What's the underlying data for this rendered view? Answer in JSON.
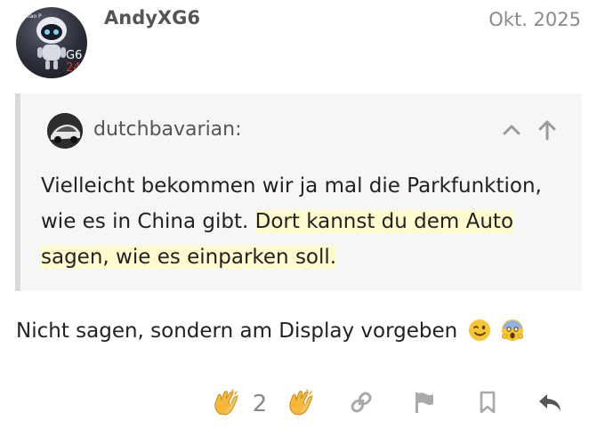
{
  "post": {
    "author": "AndyXG6",
    "date": "Okt. 2025",
    "avatar_badge_top": "G6",
    "avatar_badge_bottom": "24",
    "avatar_caption": "Xiao P"
  },
  "quote": {
    "author": "dutchbavarian:",
    "text_plain": "Vielleicht bekommen wir ja mal die Parkfunktion, wie es in China gibt. ",
    "text_highlighted": "Dort kannst du dem Auto sagen, wie es einparken soll.",
    "controls": [
      "chevron-up-icon",
      "arrow-up-icon"
    ]
  },
  "reply": {
    "text": "Nicht sagen, sondern am Display vorgeben",
    "emojis": [
      "winking-face",
      "face-screaming"
    ]
  },
  "actions": {
    "like_count": "2",
    "icons": [
      "clapping-hands-icon",
      "clapping-hands-icon",
      "link-icon",
      "flag-icon",
      "bookmark-icon",
      "reply-icon"
    ]
  },
  "colors": {
    "highlight": "#fffbcf",
    "quote_bg": "#f6f6f6",
    "quote_border": "#d9d9d9",
    "muted": "#888888",
    "text": "#222222"
  }
}
